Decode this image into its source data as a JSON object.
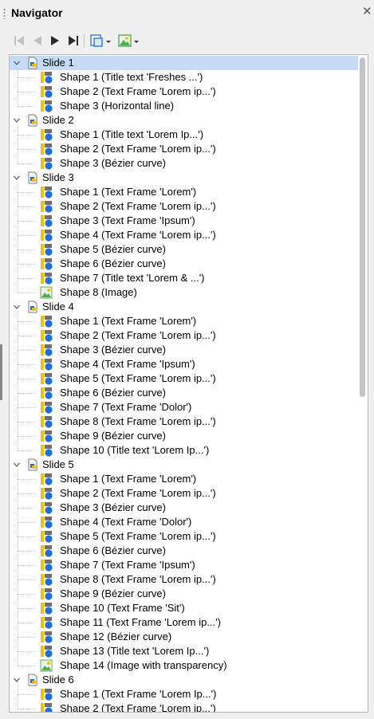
{
  "panel": {
    "title": "Navigator",
    "close_icon": "close-icon"
  },
  "toolbar": {
    "buttons": [
      {
        "name": "first-slide-icon",
        "enabled": false
      },
      {
        "name": "previous-slide-icon",
        "enabled": false
      },
      {
        "name": "next-slide-icon",
        "enabled": true
      },
      {
        "name": "last-slide-icon",
        "enabled": true
      },
      {
        "name": "drag-mode-icon",
        "enabled": true
      },
      {
        "name": "show-shapes-icon",
        "enabled": true
      }
    ]
  },
  "colors": {
    "selection": "#c5dcf6",
    "shape_blue": "#1e6fd9",
    "shape_yellow": "#f2c200",
    "shape_gray": "#6e6e6e"
  },
  "slides": [
    {
      "label": "Slide 1",
      "expanded": true,
      "selected": true,
      "shapes": [
        {
          "label": "Shape 1 (Title text 'Freshes ...')",
          "icon": "shape-icon"
        },
        {
          "label": "Shape 2 (Text Frame 'Lorem ip...')",
          "icon": "shape-icon"
        },
        {
          "label": "Shape 3 (Horizontal line)",
          "icon": "shape-icon"
        }
      ]
    },
    {
      "label": "Slide 2",
      "expanded": true,
      "selected": false,
      "shapes": [
        {
          "label": "Shape 1 (Title text 'Lorem Ip...')",
          "icon": "shape-icon"
        },
        {
          "label": "Shape 2 (Text Frame 'Lorem ip...')",
          "icon": "shape-icon"
        },
        {
          "label": "Shape 3 (Bézier curve)",
          "icon": "shape-icon"
        }
      ]
    },
    {
      "label": "Slide 3",
      "expanded": true,
      "selected": false,
      "shapes": [
        {
          "label": "Shape 1 (Text Frame 'Lorem')",
          "icon": "shape-icon"
        },
        {
          "label": "Shape 2 (Text Frame 'Lorem ip...')",
          "icon": "shape-icon"
        },
        {
          "label": "Shape 3 (Text Frame 'Ipsum')",
          "icon": "shape-icon"
        },
        {
          "label": "Shape 4 (Text Frame 'Lorem ip...')",
          "icon": "shape-icon"
        },
        {
          "label": "Shape 5 (Bézier curve)",
          "icon": "shape-icon"
        },
        {
          "label": "Shape 6 (Bézier curve)",
          "icon": "shape-icon"
        },
        {
          "label": "Shape 7 (Title text 'Lorem & ...')",
          "icon": "shape-icon"
        },
        {
          "label": "Shape 8 (Image)",
          "icon": "image-icon"
        }
      ]
    },
    {
      "label": "Slide 4",
      "expanded": true,
      "selected": false,
      "shapes": [
        {
          "label": "Shape 1 (Text Frame 'Lorem')",
          "icon": "shape-icon"
        },
        {
          "label": "Shape 2 (Text Frame 'Lorem ip...')",
          "icon": "shape-icon"
        },
        {
          "label": "Shape 3 (Bézier curve)",
          "icon": "shape-icon"
        },
        {
          "label": "Shape 4 (Text Frame 'Ipsum')",
          "icon": "shape-icon"
        },
        {
          "label": "Shape 5 (Text Frame 'Lorem ip...')",
          "icon": "shape-icon"
        },
        {
          "label": "Shape 6 (Bézier curve)",
          "icon": "shape-icon"
        },
        {
          "label": "Shape 7 (Text Frame 'Dolor')",
          "icon": "shape-icon"
        },
        {
          "label": "Shape 8 (Text Frame 'Lorem ip...')",
          "icon": "shape-icon"
        },
        {
          "label": "Shape 9 (Bézier curve)",
          "icon": "shape-icon"
        },
        {
          "label": "Shape 10 (Title text 'Lorem Ip...')",
          "icon": "shape-icon"
        }
      ]
    },
    {
      "label": "Slide 5",
      "expanded": true,
      "selected": false,
      "shapes": [
        {
          "label": "Shape 1 (Text Frame 'Lorem')",
          "icon": "shape-icon"
        },
        {
          "label": "Shape 2 (Text Frame 'Lorem ip...')",
          "icon": "shape-icon"
        },
        {
          "label": "Shape 3 (Bézier curve)",
          "icon": "shape-icon"
        },
        {
          "label": "Shape 4 (Text Frame 'Dolor')",
          "icon": "shape-icon"
        },
        {
          "label": "Shape 5 (Text Frame 'Lorem ip...')",
          "icon": "shape-icon"
        },
        {
          "label": "Shape 6 (Bézier curve)",
          "icon": "shape-icon"
        },
        {
          "label": "Shape 7 (Text Frame 'Ipsum')",
          "icon": "shape-icon"
        },
        {
          "label": "Shape 8 (Text Frame 'Lorem ip...')",
          "icon": "shape-icon"
        },
        {
          "label": "Shape 9 (Bézier curve)",
          "icon": "shape-icon"
        },
        {
          "label": "Shape 10 (Text Frame 'Sit')",
          "icon": "shape-icon"
        },
        {
          "label": "Shape 11 (Text Frame 'Lorem ip...')",
          "icon": "shape-icon"
        },
        {
          "label": "Shape 12 (Bézier curve)",
          "icon": "shape-icon"
        },
        {
          "label": "Shape 13 (Title text 'Lorem Ip...')",
          "icon": "shape-icon"
        },
        {
          "label": "Shape 14 (Image with transparency)",
          "icon": "image-icon"
        }
      ]
    },
    {
      "label": "Slide 6",
      "expanded": true,
      "selected": false,
      "shapes": [
        {
          "label": "Shape 1 (Text Frame 'Lorem Ip...')",
          "icon": "shape-icon"
        },
        {
          "label": "Shape 2 (Text Frame 'Lorem ip...')",
          "icon": "shape-icon"
        }
      ]
    }
  ]
}
